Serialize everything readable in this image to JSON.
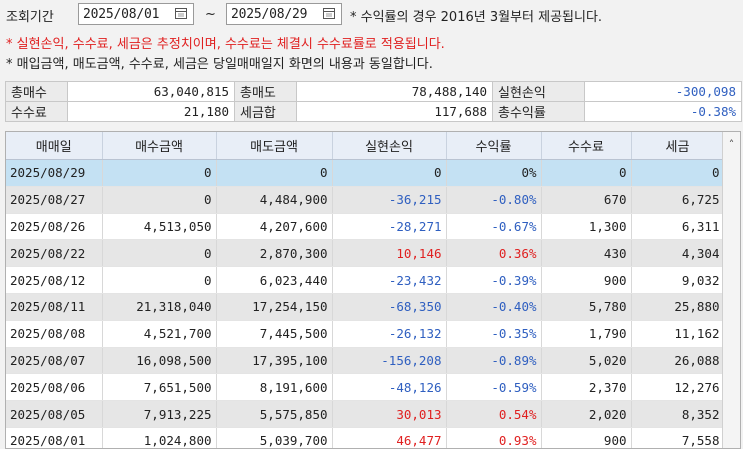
{
  "filter": {
    "period_label": "조회기간",
    "start_date": "2025/08/01",
    "end_date": "2025/08/29",
    "tilde": "~",
    "note_return": "* 수익률의 경우 2016년 3월부터 제공됩니다.",
    "note_estimate": "* 실현손익, 수수료, 세금은 추정치이며, 수수료는 체결시 수수료률로 적용됩니다.",
    "note_same": "* 매입금액, 매도금액, 수수료, 세금은 당일매매일지 화면의 내용과 동일합니다."
  },
  "summary": {
    "total_buy_label": "총매수",
    "total_buy": "63,040,815",
    "total_sell_label": "총매도",
    "total_sell": "78,488,140",
    "realized_label": "실현손익",
    "realized": "-300,098",
    "fee_label": "수수료",
    "fee": "21,180",
    "tax_label": "세금합",
    "tax": "117,688",
    "total_return_label": "총수익률",
    "total_return": "-0.38%"
  },
  "grid": {
    "columns": [
      "매매일",
      "매수금액",
      "매도금액",
      "실현손익",
      "수익률",
      "수수료",
      "세금"
    ],
    "rows": [
      {
        "date": "2025/08/29",
        "buy": "0",
        "sell": "0",
        "pnl": "0",
        "ret": "0%",
        "fee": "0",
        "tax": "0",
        "sign": "zero"
      },
      {
        "date": "2025/08/27",
        "buy": "0",
        "sell": "4,484,900",
        "pnl": "-36,215",
        "ret": "-0.80%",
        "fee": "670",
        "tax": "6,725",
        "sign": "neg"
      },
      {
        "date": "2025/08/26",
        "buy": "4,513,050",
        "sell": "4,207,600",
        "pnl": "-28,271",
        "ret": "-0.67%",
        "fee": "1,300",
        "tax": "6,311",
        "sign": "neg"
      },
      {
        "date": "2025/08/22",
        "buy": "0",
        "sell": "2,870,300",
        "pnl": "10,146",
        "ret": "0.36%",
        "fee": "430",
        "tax": "4,304",
        "sign": "pos"
      },
      {
        "date": "2025/08/12",
        "buy": "0",
        "sell": "6,023,440",
        "pnl": "-23,432",
        "ret": "-0.39%",
        "fee": "900",
        "tax": "9,032",
        "sign": "neg"
      },
      {
        "date": "2025/08/11",
        "buy": "21,318,040",
        "sell": "17,254,150",
        "pnl": "-68,350",
        "ret": "-0.40%",
        "fee": "5,780",
        "tax": "25,880",
        "sign": "neg"
      },
      {
        "date": "2025/08/08",
        "buy": "4,521,700",
        "sell": "7,445,500",
        "pnl": "-26,132",
        "ret": "-0.35%",
        "fee": "1,790",
        "tax": "11,162",
        "sign": "neg"
      },
      {
        "date": "2025/08/07",
        "buy": "16,098,500",
        "sell": "17,395,100",
        "pnl": "-156,208",
        "ret": "-0.89%",
        "fee": "5,020",
        "tax": "26,088",
        "sign": "neg"
      },
      {
        "date": "2025/08/06",
        "buy": "7,651,500",
        "sell": "8,191,600",
        "pnl": "-48,126",
        "ret": "-0.59%",
        "fee": "2,370",
        "tax": "12,276",
        "sign": "neg"
      },
      {
        "date": "2025/08/05",
        "buy": "7,913,225",
        "sell": "5,575,850",
        "pnl": "30,013",
        "ret": "0.54%",
        "fee": "2,020",
        "tax": "8,352",
        "sign": "pos"
      },
      {
        "date": "2025/08/01",
        "buy": "1,024,800",
        "sell": "5,039,700",
        "pnl": "46,477",
        "ret": "0.93%",
        "fee": "900",
        "tax": "7,558",
        "sign": "pos"
      }
    ]
  },
  "colors": {
    "negative": "#2f5fc0",
    "positive": "#e02020",
    "selected": "#c4e1f3",
    "header": "#e8eef7"
  },
  "icons": {
    "calendar": "calendar-icon",
    "scroll_up": "chevron-up-icon"
  }
}
